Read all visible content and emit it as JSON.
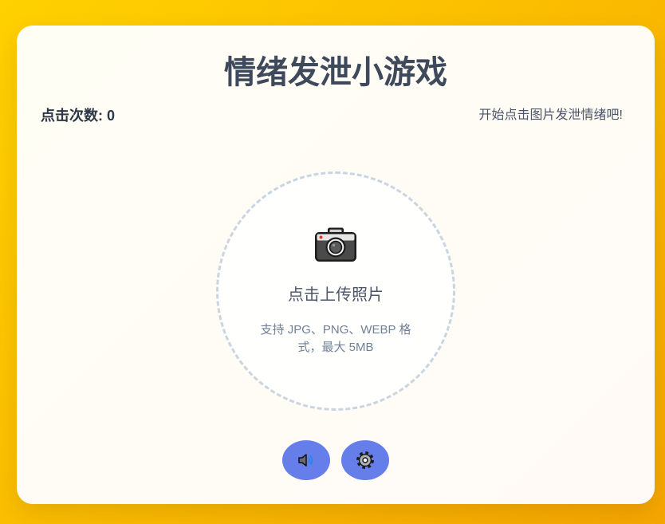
{
  "title": "情绪发泄小游戏",
  "stats": {
    "click_count_label": "点击次数:",
    "click_count_value": "0",
    "hint": "开始点击图片发泄情绪吧!"
  },
  "upload": {
    "icon": "camera-icon",
    "label": "点击上传照片",
    "formats": "支持 JPG、PNG、WEBP 格式，最大 5MB"
  },
  "controls": {
    "sound_icon": "speaker-icon",
    "settings_icon": "gear-icon"
  },
  "colors": {
    "background_start": "#ffd100",
    "background_end": "#f6a600",
    "card": "#fffef5",
    "title": "#3e4a5b",
    "accent": "#667eea",
    "upload_border": "#cbd5e0"
  }
}
